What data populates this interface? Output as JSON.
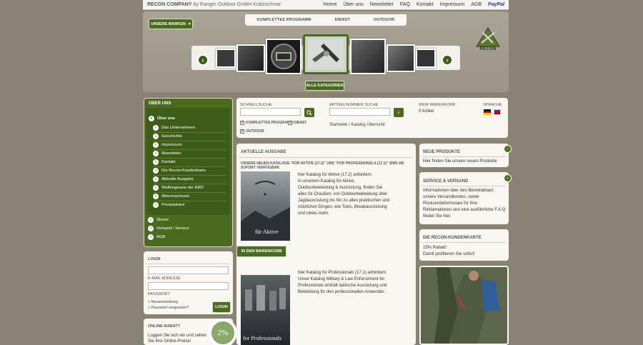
{
  "topbar": {
    "brand": "RECON COMPANY",
    "brand_suffix": "by Ranger Outdoor GmbH Krätzschmar",
    "nav": [
      "Home",
      "Über uns",
      "Newsletter",
      "FAQ",
      "Kontakt",
      "Impressum",
      "AGB"
    ],
    "paypal": "PayPal"
  },
  "category_tabs": [
    "KOMPLETTES PROGRAMM",
    "DIENST",
    "OUTDOOR"
  ],
  "hero": {
    "brands_button": "UNSERE MARKEN",
    "brands_caret": "▾",
    "prev_arrow": "‹",
    "next_arrow": "›",
    "all_categories": "ALLE KATEGORIEN",
    "logo_text": "RECON"
  },
  "sidebar": {
    "title": "ÜBER UNS",
    "items": [
      {
        "label": "Über uns",
        "open": true
      },
      {
        "label": "Das Unternehmen"
      },
      {
        "label": "Geschichte"
      },
      {
        "label": "Impressum"
      },
      {
        "label": "Newsletter"
      },
      {
        "label": "Kontakt"
      },
      {
        "label": "Die Recon-Kundenkarte"
      },
      {
        "label": "Aktuelle Ausgabe"
      },
      {
        "label": "Waffengesetz der BRD"
      },
      {
        "label": "Altersnachweis"
      },
      {
        "label": "Privatsphäre"
      },
      {
        "label": "Stores"
      },
      {
        "label": "Versand / Service"
      },
      {
        "label": "AGB"
      }
    ]
  },
  "login": {
    "title": "LOGIN",
    "email_label": "E-MAIL ADRESSE",
    "password_label": "PASSWORT",
    "register_link": "» Neuanmeldung",
    "forgot_link": "» Passwort vergessen?",
    "button": "LOGIN"
  },
  "online_rabatt": {
    "title": "ONLINE-RABATT",
    "text_1": "Loggen Sie sich ein und sehen",
    "text_2": "Sie Ihre Online-Preise!",
    "badge": "2%"
  },
  "search": {
    "quick_label": "SCHNELLSUCHE",
    "quick_placeholder": "",
    "article_label": "ARTIKELNUMMER SUCHE",
    "article_placeholder": "",
    "search_icon": "search-icon",
    "checks": [
      {
        "label": "KOMPLETTES PROGRAMM",
        "checked": true
      },
      {
        "label": "DIENST",
        "checked": true
      },
      {
        "label": "OUTDOOR",
        "checked": true
      }
    ],
    "breadcrumb": "Startseite / Katalog Übersicht",
    "cart_label": "MEIN WARENKORB",
    "cart_value": "0 Artikel",
    "lang_label": "SPRACHE"
  },
  "main": {
    "heading": "AKTUELLE AUSGABE",
    "subheading": "UNSERE NEUEN KATALOGE \"FÜR AKTIVE (17.2)\" UND \"FOR PROFESSIONALS (17.1)\" SIND AB SOFORT VERFÜGBAR.",
    "catalog1": {
      "cover_text": "für Aktive",
      "lines": [
        "hier Katalog für Aktive (17.2) anfordern",
        "In unserem Katalog für Aktive,",
        "Outdoorbekleidung & Ausrüstung, finden Sie",
        "alles für Draußen; von Outdoorbekleidung über",
        "Jagdausrüstung bis hin zu allen praktischen und",
        "nützlichen Dingen, wie Tools, Biwakausrüstung",
        "und vieles mehr."
      ]
    },
    "cart_button": "IN DEN WARENKORB",
    "catalog2": {
      "cover_text": "for Professionals",
      "lines": [
        "hier Katalog for Professionals (17.1) anfordern",
        "Unser Katalog Military & Law Enforcement for",
        "Professionals enthält taktische Ausrüstung und",
        "Bekleidung für den professionellen Anwender."
      ]
    }
  },
  "right": {
    "new_products": {
      "title": "NEUE PRODUKTE",
      "text": "Hier finden Sie unsere neuen Produkte"
    },
    "service": {
      "title": "SERVICE & VERSAND",
      "lines": [
        "Informationen über den Bestellablauf,",
        "unsere Versandkosten, sowie",
        "Rücksendeformulare für Ihre",
        "Reklamationen und eine ausführliche F.A.Q",
        "finden Sie hier."
      ]
    },
    "card": {
      "title": "DIE RECON-KUNDENKARTE",
      "line1": "15% Rabatt!",
      "line2": "Damit profitieren Sie sofort!"
    },
    "arrow": "›"
  },
  "colors": {
    "green": "#4a6a1e",
    "dark_green": "#3e5c18",
    "background": "#8a8275",
    "panel": "#f7f6f1"
  }
}
